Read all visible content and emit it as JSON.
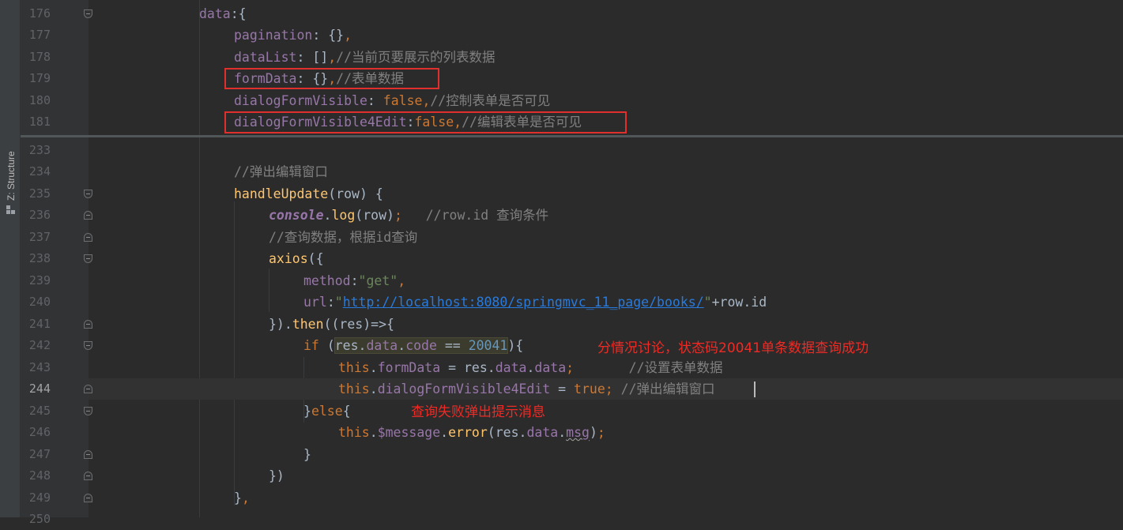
{
  "side_panel": {
    "structure_label": "Z: Structure"
  },
  "lines_top": [
    {
      "num": "176",
      "tokens": [
        [
          "p",
          "data"
        ],
        [
          "w",
          ":{"
        ]
      ]
    },
    {
      "num": "177",
      "tokens": [
        [
          "p",
          "pagination"
        ],
        [
          "w",
          ": {}"
        ],
        [
          "k",
          ","
        ]
      ]
    },
    {
      "num": "178",
      "tokens": [
        [
          "p",
          "dataList"
        ],
        [
          "w",
          ": []"
        ],
        [
          "k",
          ","
        ],
        [
          "c",
          "//当前页要展示的列表数据"
        ]
      ]
    },
    {
      "num": "179",
      "tokens": [
        [
          "p",
          "formData"
        ],
        [
          "w",
          ": {}"
        ],
        [
          "k",
          ","
        ],
        [
          "c",
          "//表单数据"
        ]
      ]
    },
    {
      "num": "180",
      "tokens": [
        [
          "p",
          "dialogFormVisible"
        ],
        [
          "w",
          ": "
        ],
        [
          "k",
          "false"
        ],
        [
          "k",
          ","
        ],
        [
          "c",
          "//控制表单是否可见"
        ]
      ]
    },
    {
      "num": "181",
      "tokens": [
        [
          "p",
          "dialogFormVisible4Edit"
        ],
        [
          "w",
          ":"
        ],
        [
          "k",
          "false"
        ],
        [
          "k",
          ","
        ],
        [
          "c",
          "//编辑表单是否可见"
        ]
      ]
    }
  ],
  "lines_bottom": [
    {
      "num": "233",
      "tokens": []
    },
    {
      "num": "234",
      "tokens": [
        [
          "c",
          "//弹出编辑窗口"
        ]
      ]
    },
    {
      "num": "235",
      "tokens": [
        [
          "f",
          "handleUpdate"
        ],
        [
          "w",
          "(row) {"
        ]
      ]
    },
    {
      "num": "236",
      "tokens": [
        [
          "i",
          "console"
        ],
        [
          "w",
          "."
        ],
        [
          "f",
          "log"
        ],
        [
          "w",
          "(row)"
        ],
        [
          "k",
          ";"
        ],
        [
          "w",
          "   "
        ],
        [
          "c",
          "//row.id 查询条件"
        ]
      ]
    },
    {
      "num": "237",
      "tokens": [
        [
          "c",
          "//查询数据，根据id查询"
        ]
      ]
    },
    {
      "num": "238",
      "tokens": [
        [
          "f",
          "axios"
        ],
        [
          "w",
          "({"
        ]
      ]
    },
    {
      "num": "239",
      "tokens": [
        [
          "p",
          "method"
        ],
        [
          "w",
          ":"
        ],
        [
          "s",
          "\"get\""
        ],
        [
          "k",
          ","
        ]
      ]
    },
    {
      "num": "240",
      "tokens": [
        [
          "p",
          "url"
        ],
        [
          "w",
          ":"
        ],
        [
          "s",
          "\""
        ],
        [
          "l",
          "http://localhost:8080/springmvc_11_page/books/"
        ],
        [
          "s",
          "\""
        ],
        [
          "w",
          "+row."
        ],
        [
          "w",
          "id"
        ]
      ]
    },
    {
      "num": "241",
      "tokens": [
        [
          "w",
          "})."
        ],
        [
          "f",
          "then"
        ],
        [
          "w",
          "((res)=>{"
        ]
      ]
    },
    {
      "num": "242",
      "tokens": [
        [
          "k",
          "if "
        ],
        [
          "w",
          "("
        ],
        [
          "h",
          "res.data.code == 20041"
        ],
        [
          "w",
          "){"
        ]
      ]
    },
    {
      "num": "243",
      "tokens": [
        [
          "k",
          "this"
        ],
        [
          "w",
          "."
        ],
        [
          "p",
          "formData"
        ],
        [
          "w",
          " = res."
        ],
        [
          "p",
          "data"
        ],
        [
          "w",
          "."
        ],
        [
          "p",
          "data"
        ],
        [
          "k",
          ";"
        ],
        [
          "w",
          "       "
        ],
        [
          "c",
          "//设置表单数据"
        ]
      ]
    },
    {
      "num": "244",
      "tokens": [
        [
          "k",
          "this"
        ],
        [
          "w",
          "."
        ],
        [
          "p",
          "dialogFormVisible4Edit"
        ],
        [
          "w",
          " = "
        ],
        [
          "k",
          "true"
        ],
        [
          "k",
          ";"
        ],
        [
          "w",
          " "
        ],
        [
          "c",
          "//弹出编辑窗口"
        ]
      ]
    },
    {
      "num": "245",
      "tokens": [
        [
          "w",
          "}"
        ],
        [
          "k",
          "else"
        ],
        [
          "w",
          "{"
        ]
      ]
    },
    {
      "num": "246",
      "tokens": [
        [
          "k",
          "this"
        ],
        [
          "w",
          "."
        ],
        [
          "p",
          "$message"
        ],
        [
          "w",
          "."
        ],
        [
          "f",
          "error"
        ],
        [
          "w",
          "(res."
        ],
        [
          "p",
          "data"
        ],
        [
          "w",
          "."
        ],
        [
          "q",
          "msg"
        ],
        [
          "w",
          ")"
        ],
        [
          "k",
          ";"
        ]
      ]
    },
    {
      "num": "247",
      "tokens": [
        [
          "w",
          "}"
        ]
      ]
    },
    {
      "num": "248",
      "tokens": [
        [
          "w",
          "})"
        ]
      ]
    },
    {
      "num": "249",
      "tokens": [
        [
          "w",
          "}"
        ],
        [
          "k",
          ","
        ]
      ]
    },
    {
      "num": "250",
      "tokens": []
    }
  ],
  "annotations": {
    "success_note": "分情况讨论，状态码20041单条数据查询成功",
    "failure_note": "查询失败弹出提示消息"
  },
  "colors": {
    "background": "#2b2b2b",
    "keyword": "#cc7832",
    "property": "#9876aa",
    "string": "#6a8759",
    "comment": "#808080",
    "function": "#ffc66d",
    "number": "#6897bb",
    "annotation_red": "#e0302e"
  }
}
